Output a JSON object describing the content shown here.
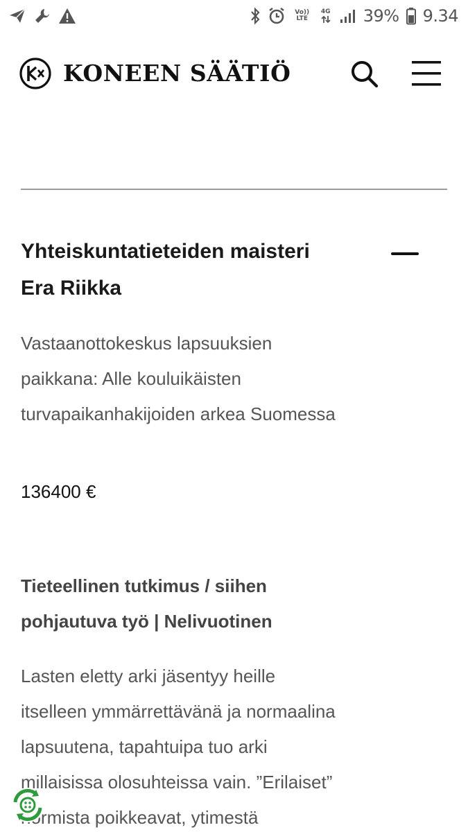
{
  "status_bar": {
    "battery": "39%",
    "time": "9.34",
    "volte_top": "Vo))",
    "volte_bottom": "LTE",
    "network": "4G",
    "icons": [
      "send-icon",
      "wrench-icon",
      "warning-icon",
      "bluetooth-icon",
      "alarm-icon",
      "volte-icon",
      "data-arrows-icon",
      "signal-icon",
      "battery-icon"
    ]
  },
  "header": {
    "logo_text": "KONEEN SÄÄTIÖ",
    "icons": [
      "koneen-logo-icon",
      "search-icon",
      "hamburger-menu-icon"
    ]
  },
  "grant": {
    "title_line1": "Yhteiskuntatieteiden maisteri",
    "title_line2": "Era Riikka",
    "project_line1": "Vastaanottokeskus lapsuuksien",
    "project_line2": "paikkana: Alle kouluikäisten",
    "project_line3": "turvapaikanhakijoiden arkea Suomessa",
    "amount": "136400 €",
    "category_line1": "Tieteellinen tutkimus / siihen",
    "category_line2": "pohjautuva työ | Nelivuotinen",
    "abstract_line1": "Lasten eletty arki jäsentyy heille",
    "abstract_line2": "itselleen ymmärrettävänä ja normaalina",
    "abstract_line3": "lapsuutena, tapahtuipa tuo arki",
    "abstract_line4": "millaisissa olosuhteissa vain. ”Erilaiset”",
    "abstract_line5": "normista poikkeavat, ytimestä"
  },
  "colors": {
    "text_dark": "#1a1a1a",
    "text_muted": "#555555",
    "divider": "#9a9a9a",
    "floating_button_green": "#2e9b3e"
  }
}
